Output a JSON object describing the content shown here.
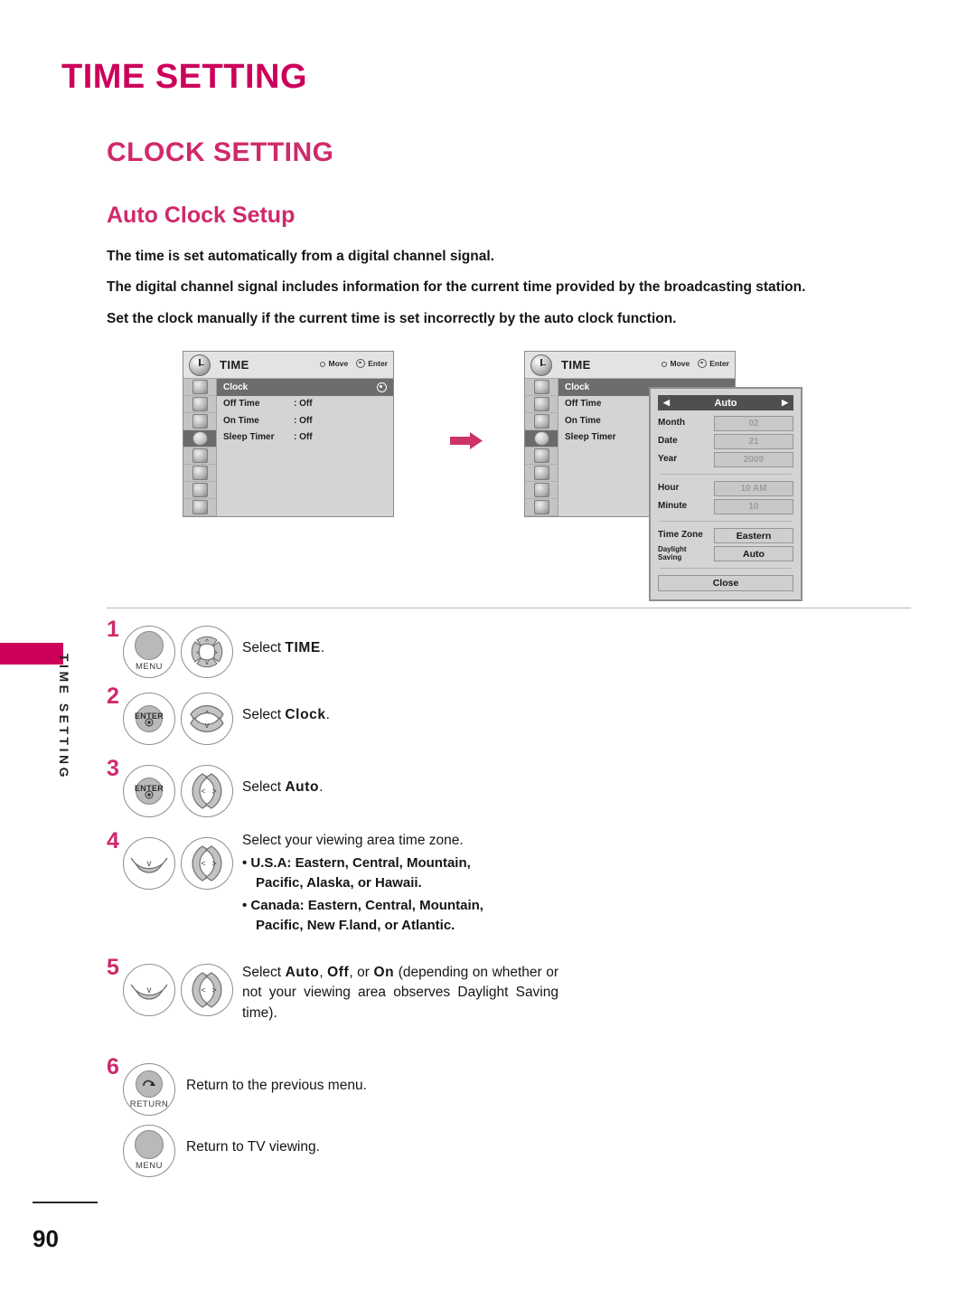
{
  "page": {
    "title": "TIME SETTING",
    "section": "CLOCK SETTING",
    "subsection": "Auto Clock Setup",
    "number": "90",
    "side_tab_label": "TIME SETTING",
    "accent_color": "#CC005A",
    "heading_color": "#D0296B"
  },
  "intro": {
    "line1": "The time is set automatically from a digital channel signal.",
    "line2": "The digital channel signal includes information for the current time provided by the broadcasting station.",
    "line3": "Set the clock manually if the current time is set incorrectly by the auto clock function."
  },
  "osd": {
    "title": "TIME",
    "hint_move": "Move",
    "hint_enter": "Enter",
    "rows": [
      {
        "label": "Clock",
        "value": "",
        "selected": true
      },
      {
        "label": "Off Time",
        "value": ": Off",
        "selected": false
      },
      {
        "label": "On Time",
        "value": ": Off",
        "selected": false
      },
      {
        "label": "Sleep Timer",
        "value": ": Off",
        "selected": false
      }
    ],
    "rail_icons": [
      "picture-icon",
      "screen-icon",
      "audio-icon",
      "time-icon",
      "lock-icon",
      "option-icon",
      "input-icon",
      "usb-icon"
    ],
    "active_rail_index": 3
  },
  "clock_dialog": {
    "mode": "Auto",
    "arrow_left": "◀",
    "arrow_right": "▶",
    "fields": [
      {
        "label": "Month",
        "value": "02",
        "dim": true
      },
      {
        "label": "Date",
        "value": "21",
        "dim": true
      },
      {
        "label": "Year",
        "value": "2009",
        "dim": true
      }
    ],
    "time_fields": [
      {
        "label": "Hour",
        "value": "10 AM",
        "dim": true
      },
      {
        "label": "Minute",
        "value": "10",
        "dim": true
      }
    ],
    "zone_fields": [
      {
        "label": "Time Zone",
        "value": "Eastern",
        "dim": false
      },
      {
        "label": "Daylight\nSaving",
        "value": "Auto",
        "dim": false
      }
    ],
    "daylight_label_line1": "Daylight",
    "daylight_label_line2": "Saving",
    "close_label": "Close"
  },
  "steps": [
    {
      "num": "1",
      "buttons": [
        "MENU",
        "dpad-4way"
      ],
      "text_plain_1": "Select ",
      "text_bold_1": "TIME",
      "text_plain_2": "."
    },
    {
      "num": "2",
      "buttons": [
        "ENTER",
        "updown-arrows"
      ],
      "text_plain_1": "Select ",
      "text_bold_1": "Clock",
      "text_plain_2": "."
    },
    {
      "num": "3",
      "buttons": [
        "ENTER",
        "leftright-arrows"
      ],
      "text_plain_1": "Select ",
      "text_bold_1": "Auto",
      "text_plain_2": "."
    },
    {
      "num": "4",
      "buttons": [
        "down-arrow",
        "leftright-arrows"
      ],
      "heading": "Select your viewing area time zone.",
      "bullets": [
        {
          "prefix": "• U.S.A: ",
          "items_bold": [
            "Eastern",
            "Central",
            "Mountain",
            "Pacific",
            "Alaska"
          ],
          "tail_plain": ", or ",
          "tail_bold": "Hawaii",
          "tail_end": ".",
          "line1": "• U.S.A:  Eastern,  Central,  Mountain,",
          "line2": "Pacific, Alaska, or Hawaii."
        },
        {
          "line1": "• Canada:  Eastern,  Central,  Mountain,",
          "line2": "Pacific, New F.land, or Atlantic."
        }
      ]
    },
    {
      "num": "5",
      "buttons": [
        "down-arrow",
        "leftright-arrows"
      ],
      "text_line1_a": "Select ",
      "text_line1_b1": "Auto",
      "text_line1_c": ", ",
      "text_line1_b2": "Off",
      "text_line1_d": ", or ",
      "text_line1_b3": "On",
      "text_line1_e": " (depending on",
      "text_line2": "whether or not your viewing area observes",
      "text_line3": "Daylight Saving time)."
    },
    {
      "num": "6",
      "buttons": [
        "RETURN"
      ],
      "text": "Return to the previous menu."
    },
    {
      "num": "",
      "buttons": [
        "MENU"
      ],
      "text": "Return to TV viewing."
    }
  ]
}
